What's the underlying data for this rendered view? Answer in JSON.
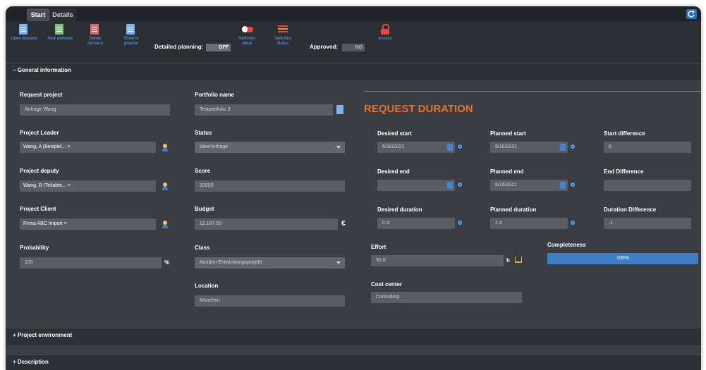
{
  "tabs": [
    {
      "label": "Start",
      "active": true
    },
    {
      "label": "Details",
      "active": false
    }
  ],
  "toolbar": {
    "open_demand": "Open demand",
    "new_demand": "New demand",
    "delete_demand": "Delete demand",
    "show_in_planner": "Show in planner",
    "detailed_planning_label": "Detailed planning:",
    "detailed_planning_value": "OFF",
    "switches_setup": "Switches setup",
    "switches_status": "Switches status",
    "approved_label": "Approved:",
    "approved_value": "NO",
    "access": "Access"
  },
  "sections": {
    "general": "− General information",
    "environment": "+ Project environment",
    "description": "+ Description"
  },
  "form": {
    "request_project": {
      "label": "Request project",
      "value": "Anfrage Wang"
    },
    "project_leader": {
      "label": "Project Leader",
      "value": "Wang, A (Beispiel... ×"
    },
    "project_deputy": {
      "label": "Project deputy",
      "value": "Wang, B (Teilabte... ×"
    },
    "project_client": {
      "label": "Project Client",
      "value": "Firma ABC Import ×"
    },
    "probability": {
      "label": "Probability",
      "value": "100",
      "unit": "%"
    },
    "portfolio_name": {
      "label": "Portfolio name",
      "value": "Testportfolio 3"
    },
    "status": {
      "label": "Status",
      "value": "Idee/Anfrage"
    },
    "score": {
      "label": "Score",
      "value": "20000"
    },
    "budget": {
      "label": "Budget",
      "value": "12,187.50",
      "unit": "€"
    },
    "class": {
      "label": "Class",
      "value": "Kunden-Entwicklungsprojekt"
    },
    "location": {
      "label": "Location",
      "value": "München"
    }
  },
  "duration": {
    "title": "REQUEST DURATION",
    "desired_start": {
      "label": "Desired start",
      "value": "6/16/2021"
    },
    "planned_start": {
      "label": "Planned start",
      "value": "6/16/2021"
    },
    "start_difference": {
      "label": "Start difference",
      "value": "0"
    },
    "desired_end": {
      "label": "Desired end",
      "value": ""
    },
    "planned_end": {
      "label": "Planned end",
      "value": "6/16/2021"
    },
    "end_difference": {
      "label": "End Difference",
      "value": ""
    },
    "desired_duration": {
      "label": "Desired duration",
      "value": "0 d"
    },
    "planned_duration": {
      "label": "Planned duration",
      "value": "1 d"
    },
    "duration_difference": {
      "label": "Duration Difference",
      "value": "-1"
    },
    "effort": {
      "label": "Effort",
      "value": "50.0",
      "unit": "h"
    },
    "completeness": {
      "label": "Completeness",
      "value": "100%",
      "fraction": 1.0
    },
    "cost_center": {
      "label": "Cost center",
      "value": "Consulting"
    }
  },
  "colors": {
    "accent_orange": "#e8702a",
    "accent_blue": "#3e7fc4",
    "panel": "#3a3e43"
  }
}
